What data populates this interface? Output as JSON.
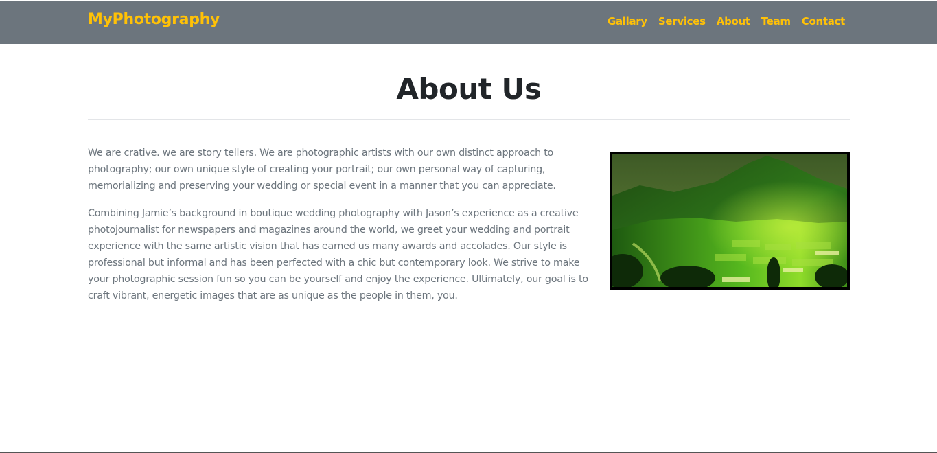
{
  "navbar": {
    "brand": "MyPhotography",
    "links": [
      "Gallary",
      "Services",
      "About",
      "Team",
      "Contact"
    ]
  },
  "main": {
    "title": "About Us",
    "paragraphs": [
      "We are crative. we are story tellers. We are photographic artists with our own distinct approach to photography; our own unique style of creating your portrait; our own personal way of capturing, memorializing and preserving your wedding or special event in a manner that you can appreciate.",
      "Combining Jamie’s background in boutique wedding photography with Jason’s experience as a creative photojournalist for newspapers and magazines around the world, we greet your wedding and portrait experience with the same artistic vision that has earned us many awards and accolades. Our style is professional but informal and has been perfected with a chic but contemporary look. We strive to make your photographic session fun so you can be yourself and enjoy the experience. Ultimately, our goal is to craft vibrant, energetic images that are as unique as the people in them, you."
    ]
  },
  "colors": {
    "navbar_bg": "#6c757d",
    "accent": "#ffc107",
    "heading": "#212529",
    "body_text": "#6c757d"
  }
}
